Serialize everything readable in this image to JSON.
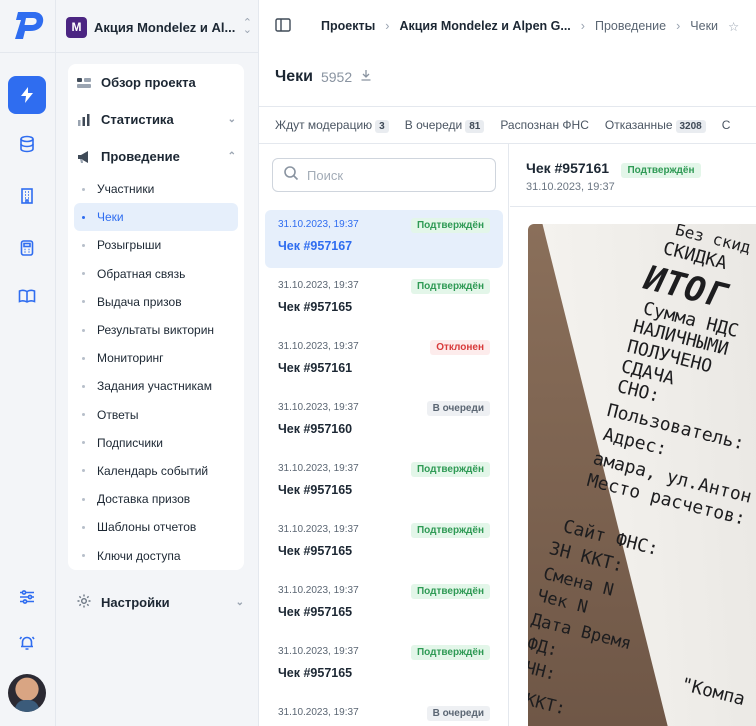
{
  "rail": {
    "icons": [
      "logo-p-icon",
      "bolt-icon",
      "database-icon",
      "building-icon",
      "calculator-icon",
      "book-icon",
      "sliders-icon",
      "bell-icon"
    ]
  },
  "project": {
    "name": "Акция Mondelez и Al...",
    "logo_letter": "M"
  },
  "menu": {
    "overview": "Обзор проекта",
    "stats": "Статистика",
    "conduct": "Проведение",
    "sub": [
      "Участники",
      "Чеки",
      "Розыгрыши",
      "Обратная связь",
      "Выдача призов",
      "Результаты викторин",
      "Мониторинг",
      "Задания участникам",
      "Ответы",
      "Подписчики",
      "Календарь событий",
      "Доставка призов",
      "Шаблоны отчетов",
      "Ключи доступа"
    ],
    "active_sub": "Чеки",
    "settings": "Настройки"
  },
  "breadcrumb": {
    "items": [
      "Проекты",
      "Акция Mondelez и Alpen G...",
      "Проведение",
      "Чеки"
    ]
  },
  "page": {
    "title": "Чеки",
    "count": "5952"
  },
  "tabs": [
    {
      "label": "Ждут модерацию",
      "badge": "3"
    },
    {
      "label": "В очереди",
      "badge": "81"
    },
    {
      "label": "Распознан ФНС",
      "badge": ""
    },
    {
      "label": "Отказанные",
      "badge": "3208"
    },
    {
      "label": "С",
      "badge": ""
    }
  ],
  "search": {
    "placeholder": "Поиск"
  },
  "receipts": [
    {
      "date": "31.10.2023, 19:37",
      "name": "Чек #957167",
      "status": "Подтверждён",
      "kind": "ok"
    },
    {
      "date": "31.10.2023, 19:37",
      "name": "Чек #957165",
      "status": "Подтверждён",
      "kind": "ok"
    },
    {
      "date": "31.10.2023, 19:37",
      "name": "Чек #957161",
      "status": "Отклонен",
      "kind": "bad"
    },
    {
      "date": "31.10.2023, 19:37",
      "name": "Чек #957160",
      "status": "В очереди",
      "kind": "q"
    },
    {
      "date": "31.10.2023, 19:37",
      "name": "Чек #957165",
      "status": "Подтверждён",
      "kind": "ok"
    },
    {
      "date": "31.10.2023, 19:37",
      "name": "Чек #957165",
      "status": "Подтверждён",
      "kind": "ok"
    },
    {
      "date": "31.10.2023, 19:37",
      "name": "Чек #957165",
      "status": "Подтверждён",
      "kind": "ok"
    },
    {
      "date": "31.10.2023, 19:37",
      "name": "Чек #957165",
      "status": "Подтверждён",
      "kind": "ok"
    },
    {
      "date": "31.10.2023, 19:37",
      "name": "",
      "status": "В очереди",
      "kind": "q"
    }
  ],
  "detail": {
    "title": "Чек #957161",
    "status": "Подтверждён",
    "date": "31.10.2023, 19:37",
    "photo_text": [
      "Без скид",
      "СКИДКА",
      "ИТОГ",
      "Сумма НДС",
      "НАЛИЧНЫМИ",
      "ПОЛУЧЕНО",
      "СДАЧА",
      "СНО:",
      "Пользователь:",
      "Адрес:",
      "амара, ул.Антон",
      "Место расчетов:",
      "Сайт ФНС:",
      "ЗН ККТ:",
      "Смена N",
      "Чек N",
      "Дата Время",
      "ФД:",
      "ЧН:",
      "ККТ:",
      "\"Компа"
    ]
  },
  "colors": {
    "accent": "#2f6df0",
    "ok": "#2f9a55",
    "bad": "#d83a3a",
    "brand": "#4b2582"
  }
}
